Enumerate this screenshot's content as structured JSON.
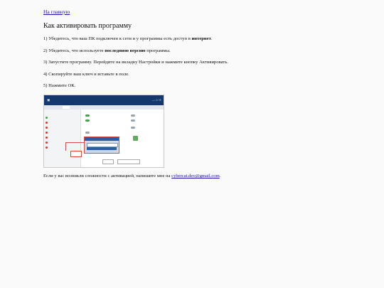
{
  "nav": {
    "home_link": "На главную"
  },
  "title": "Как активировать программу",
  "steps": [
    {
      "before": "1) Убедитесь, что ваш ПК подключен к сети и у программы есть доступ в ",
      "bold": "интернет",
      "after": "."
    },
    {
      "before": "2) Убедитесь, что используете ",
      "bold": "последнюю версию",
      "after": " программы."
    },
    {
      "text": "3) Запустите программу. Перейдите на вкладку Настройки и нажмите кнопку Активировать."
    },
    {
      "text": "4) Скопируйте ваш ключ и вставьте в поле."
    },
    {
      "text": "5) Нажмите ОК."
    }
  ],
  "footer": {
    "text": "Если у вас возникли сложности с активацией, напишите мне на ",
    "email": "cybercat.dev@gmail.com",
    "after": "."
  },
  "colors": {
    "link": "#1a0dab",
    "app_titlebar": "#14386b",
    "highlight": "#d94a4a"
  }
}
